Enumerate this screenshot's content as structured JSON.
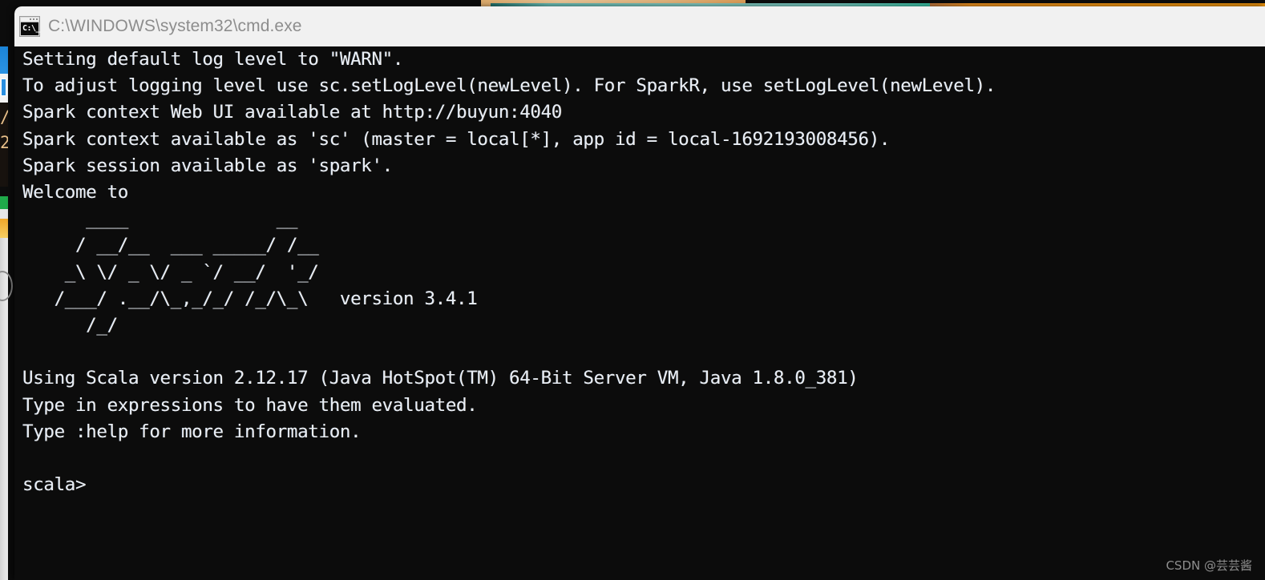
{
  "window": {
    "title": "C:\\WINDOWS\\system32\\cmd.exe",
    "icon_name": "cmd-exe-icon",
    "icon_glyph": "C:\\_",
    "titlebar_bg": "#f1f1f1",
    "title_color": "#8d8d8d"
  },
  "console": {
    "background": "#0c0c0c",
    "foreground": "#e9eef5",
    "prompt": "scala>",
    "lines": [
      "Setting default log level to \"WARN\".",
      "To adjust logging level use sc.setLogLevel(newLevel). For SparkR, use setLogLevel(newLevel).",
      "Spark context Web UI available at http://buyun:4040",
      "Spark context available as 'sc' (master = local[*], app id = local-1692193008456).",
      "Spark session available as 'spark'.",
      "Welcome to",
      "      ____              __",
      "     / __/__  ___ _____/ /__",
      "    _\\ \\/ _ \\/ _ `/ __/  '_/",
      "   /___/ .__/\\_,_/_/ /_/\\_\\   version 3.4.1",
      "      /_/",
      "",
      "Using Scala version 2.12.17 (Java HotSpot(TM) 64-Bit Server VM, Java 1.8.0_381)",
      "Type in expressions to have them evaluated.",
      "Type :help for more information.",
      "",
      "scala>"
    ],
    "details": {
      "log_level": "WARN",
      "web_ui_url": "http://buyun:4040",
      "master": "local[*]",
      "app_id": "local-1692193008456",
      "spark_version": "3.4.1",
      "scala_version": "2.12.17",
      "jvm": "Java HotSpot(TM) 64-Bit Server VM",
      "java_version": "1.8.0_381",
      "sc_variable": "sc",
      "session_variable": "spark"
    }
  },
  "background": {
    "sliver_text": "/\n2",
    "strip_colors": {
      "tan": "#ddb079",
      "teal": "#7cc2bb",
      "orange": "#e08a1e",
      "green": "#1faa4a",
      "yellow": "#f0a72a",
      "blue": "#2b93e4"
    }
  },
  "watermark": {
    "text": "CSDN @芸芸酱"
  }
}
